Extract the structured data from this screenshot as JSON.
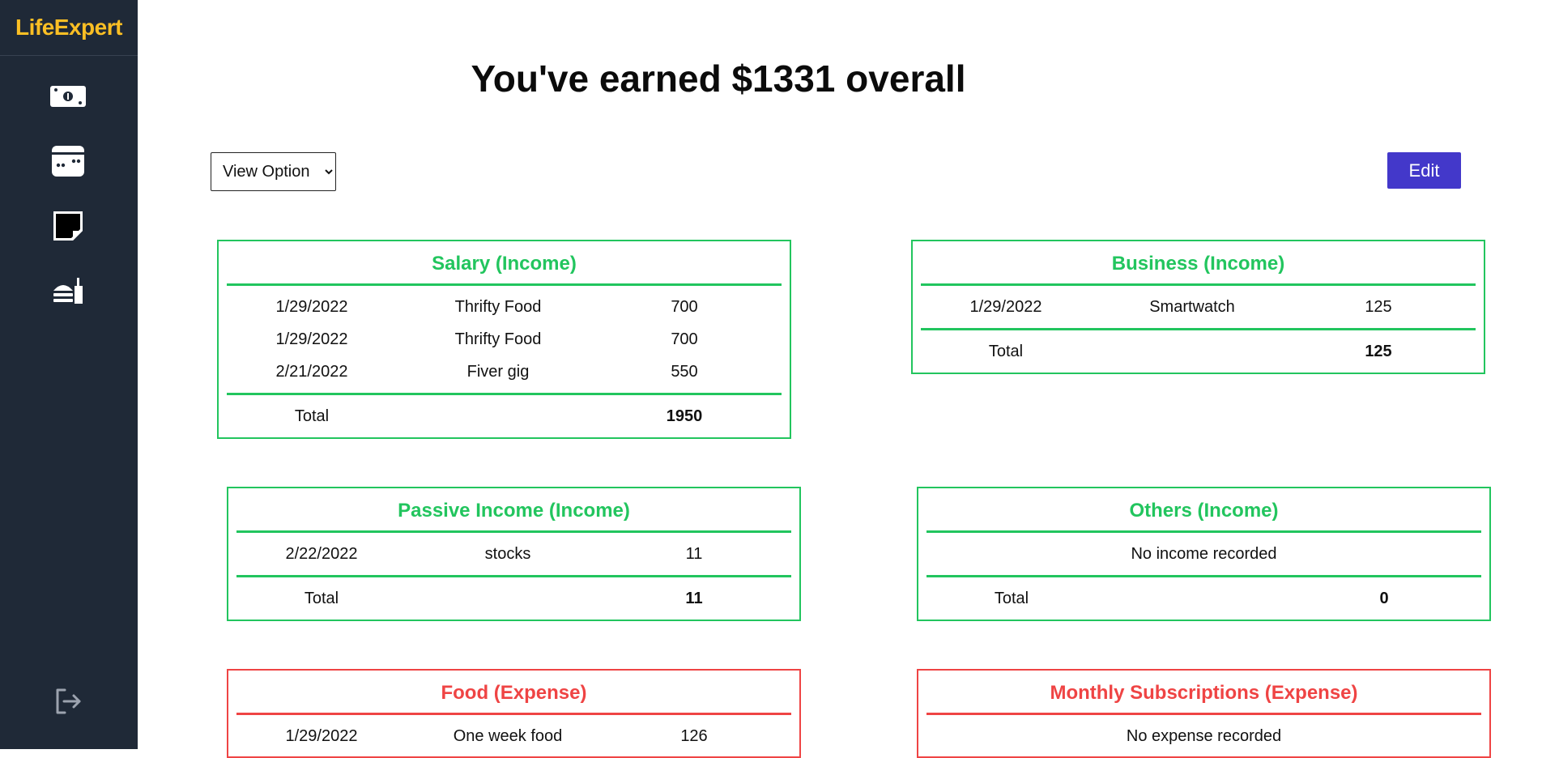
{
  "app": {
    "logo": "LifeExpert"
  },
  "sidebar": {
    "items": [
      {
        "icon": "money-icon"
      },
      {
        "icon": "browser-window-icon"
      },
      {
        "icon": "note-icon"
      },
      {
        "icon": "fast-food-icon"
      }
    ],
    "logout_icon": "logout-icon"
  },
  "header": {
    "title": "You've earned $1331 overall"
  },
  "controls": {
    "view_option": "View Option",
    "edit_label": "Edit"
  },
  "colors": {
    "income": "#22c55e",
    "expense": "#ef4444",
    "accent": "#4338ca",
    "sidebar": "#1f2937",
    "logo": "#fbbf24"
  },
  "cards": {
    "salary": {
      "title": "Salary (Income)",
      "rows": [
        {
          "date": "1/29/2022",
          "desc": "Thrifty Food",
          "amount": "700"
        },
        {
          "date": "1/29/2022",
          "desc": "Thrifty Food",
          "amount": "700"
        },
        {
          "date": "2/21/2022",
          "desc": "Fiver gig",
          "amount": "550"
        }
      ],
      "total_label": "Total",
      "total": "1950"
    },
    "business": {
      "title": "Business (Income)",
      "rows": [
        {
          "date": "1/29/2022",
          "desc": "Smartwatch",
          "amount": "125"
        }
      ],
      "total_label": "Total",
      "total": "125"
    },
    "passive": {
      "title": "Passive Income (Income)",
      "rows": [
        {
          "date": "2/22/2022",
          "desc": "stocks",
          "amount": "11"
        }
      ],
      "total_label": "Total",
      "total": "11"
    },
    "others": {
      "title": "Others (Income)",
      "empty": "No income recorded",
      "total_label": "Total",
      "total": "0"
    },
    "food": {
      "title": "Food (Expense)",
      "rows": [
        {
          "date": "1/29/2022",
          "desc": "One week food",
          "amount": "126"
        }
      ]
    },
    "subscriptions": {
      "title": "Monthly Subscriptions (Expense)",
      "empty": "No expense recorded"
    }
  }
}
